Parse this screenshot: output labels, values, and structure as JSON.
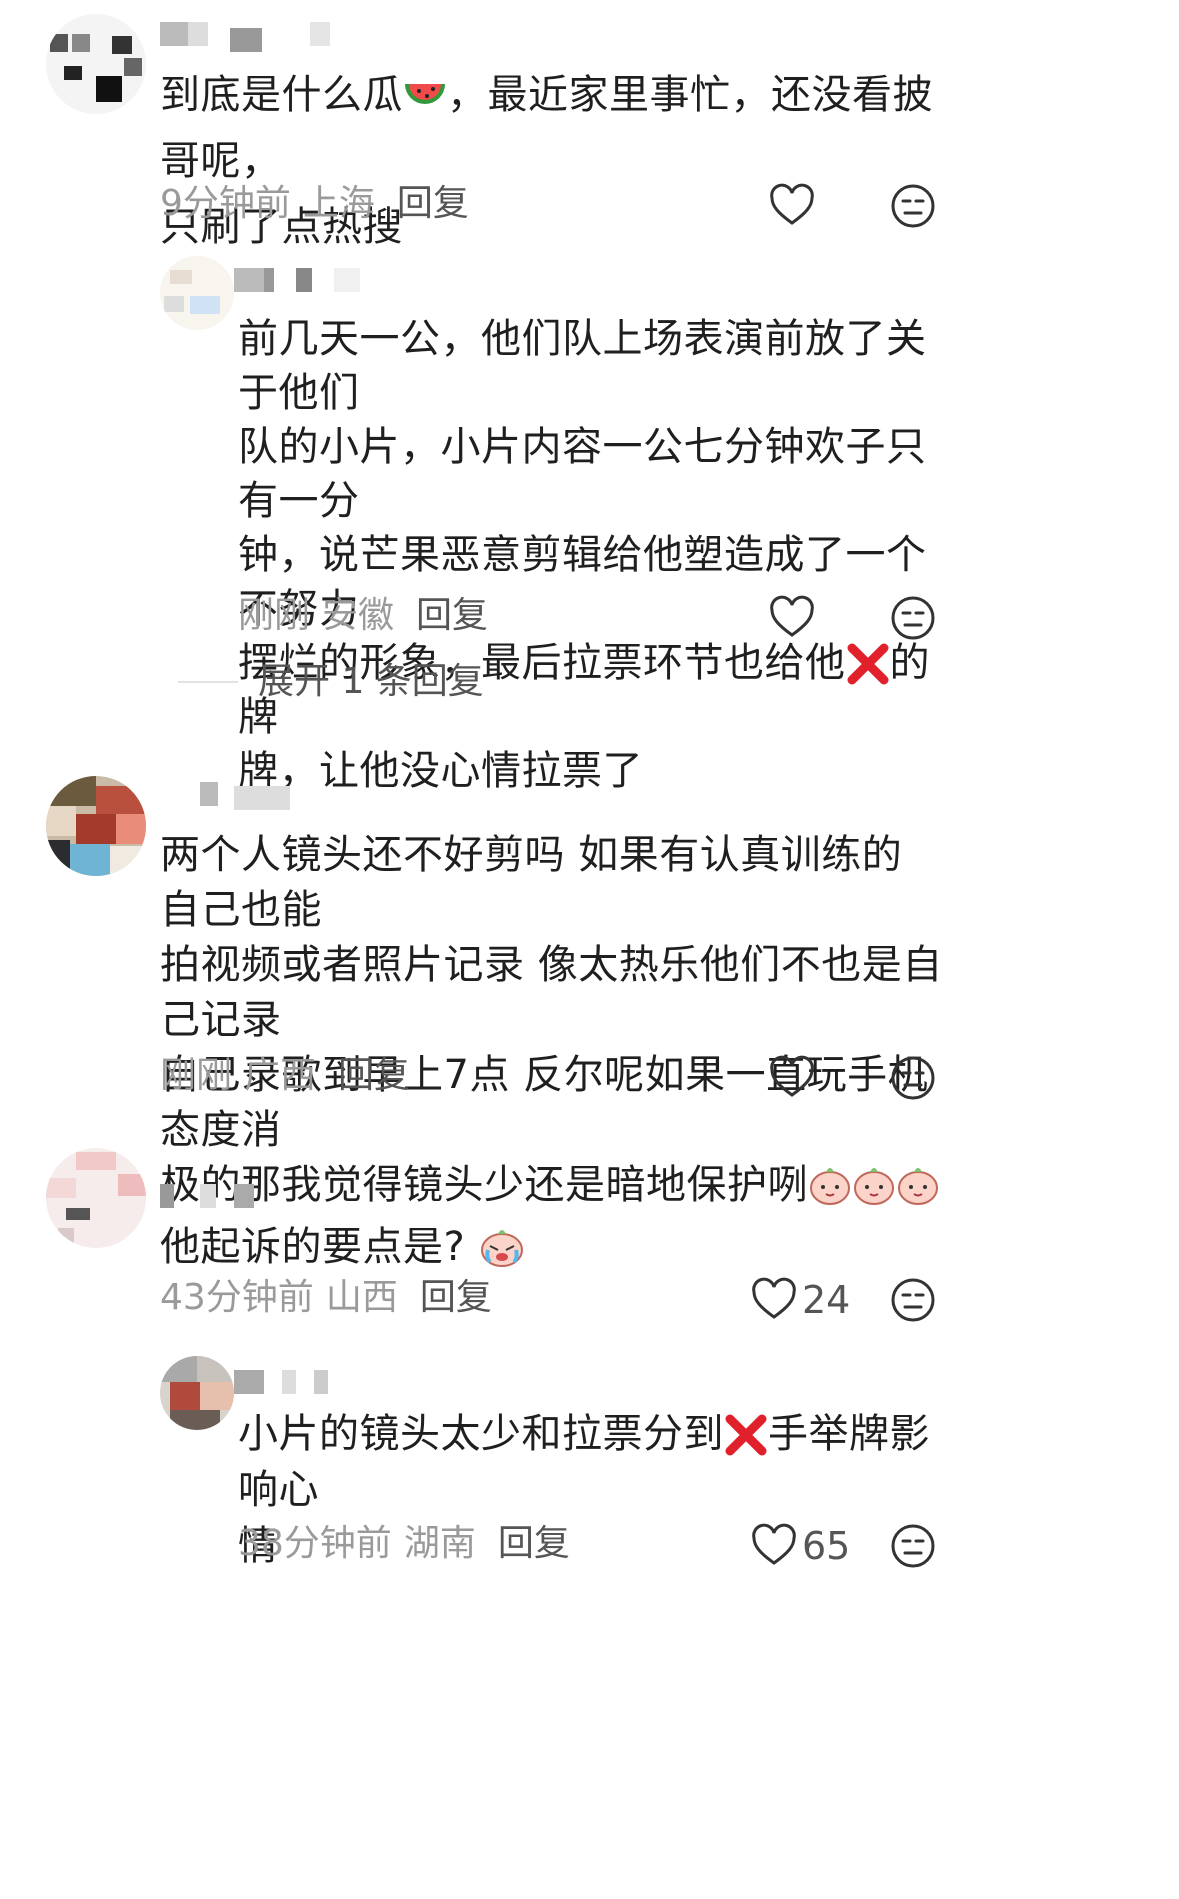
{
  "comments": [
    {
      "text_line1": "到底是什么瓜",
      "text_line1b": "，最近家里事忙，还没看披哥呢，",
      "text_line2": "只刷了点热搜",
      "time": "9分钟前",
      "location": "上海",
      "reply_label": "回复",
      "emoji": "watermelon-emoji"
    },
    {
      "reply_to": 0,
      "lines": [
        "前几天一公，他们队上场表演前放了关于他们",
        "队的小片，小片内容一公七分钟欢子只有一分",
        "钟，说芒果恶意剪辑给他塑造成了一个不努力"
      ],
      "line4a": "摆烂的形象，最后拉票环节也给他",
      "line4b": "的牌",
      "line5": "牌，让他没心情拉票了",
      "time": "刚刚",
      "location": "安徽",
      "reply_label": "回复",
      "emoji": "red-x-emoji"
    },
    {
      "lines": [
        "两个人镜头还不好剪吗 如果有认真训练的 自己也能",
        "拍视频或者照片记录 像太热乐他们不也是自己记录",
        "自己录歌到早上7点 反尔呢如果一直玩手机 态度消"
      ],
      "line4": "极的那我觉得镜头少还是暗地保护咧",
      "time": "刚刚",
      "location": "广西",
      "reply_label": "回复",
      "emoji": "peach-face-emoji"
    },
    {
      "text": "他起诉的要点是?",
      "time": "43分钟前",
      "location": "山西",
      "reply_label": "回复",
      "likes": "24",
      "emoji": "crying-peach-emoji"
    },
    {
      "reply_to": 3,
      "line1a": "小片的镜头太少和拉票分到",
      "line1b": "手举牌影响心",
      "line2": "情",
      "time": "38分钟前",
      "location": "湖南",
      "reply_label": "回复",
      "likes": "65",
      "emoji": "red-x-emoji"
    }
  ],
  "expand_replies": "展开 1 条回复",
  "icons": {
    "like": "heart-outline-icon",
    "dislike": "meh-face-icon"
  },
  "colors": {
    "text": "#1f1f1f",
    "meta": "#9a9a9a",
    "reply": "#555555",
    "red_x": "#e0202a"
  }
}
